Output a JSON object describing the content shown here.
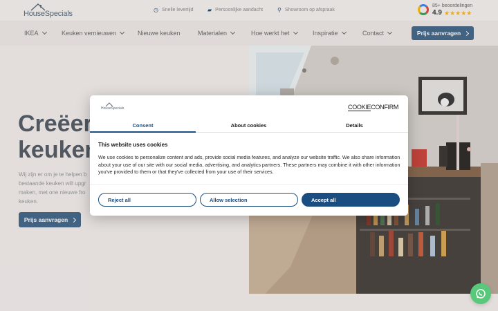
{
  "brand": {
    "name": "HouseSpecials"
  },
  "topbar": {
    "usps": [
      {
        "icon": "clock-icon",
        "label": "Snelle levertijd"
      },
      {
        "icon": "chat-icon",
        "label": "Persoonlijke aandacht"
      },
      {
        "icon": "location-pin-icon",
        "label": "Showroom op afspraak"
      }
    ],
    "google": {
      "count": "85+ beoordelingen",
      "rating": "4.9",
      "stars": "★★★★★"
    }
  },
  "nav": {
    "items": [
      {
        "label": "IKEA",
        "dropdown": true
      },
      {
        "label": "Keuken vernieuwen",
        "dropdown": true
      },
      {
        "label": "Nieuwe keuken",
        "dropdown": false
      },
      {
        "label": "Materialen",
        "dropdown": true
      },
      {
        "label": "Hoe werkt het",
        "dropdown": true
      },
      {
        "label": "Inspiratie",
        "dropdown": true
      },
      {
        "label": "Contact",
        "dropdown": true
      }
    ],
    "cta": "Prijs aanvragen"
  },
  "hero": {
    "title_line1": "Creëer",
    "title_line2": "keuken",
    "text": "Wij zijn er om je te helpen b... bestaande keuken wilt upgr... maken, met one nieuwe fro... keuken.",
    "text_lines": [
      "Wij zijn er om je te helpen b",
      "bestaande keuken wilt upgr",
      "maken, met one nieuwe fro",
      "keuken."
    ],
    "cta": "Prijs aanvragen"
  },
  "cookie": {
    "provider_left": "COOKIE",
    "provider_right": "CONFIRM",
    "tabs": [
      "Consent",
      "About cookies",
      "Details"
    ],
    "active_tab": "Consent",
    "heading": "This website uses cookies",
    "body": "We use cookies to personalize content and ads, provide social media features, and analyze our website traffic. We also share information about your use of our site with our social media, advertising, and analytics partners. These partners may combine it with other information you've provided to them or that they've collected from your use of their services.",
    "buttons": {
      "reject": "Reject all",
      "selection": "Allow selection",
      "accept": "Accept all"
    }
  },
  "colors": {
    "accent": "#45688a",
    "cookie_blue": "#1a4d80",
    "whatsapp": "#58c97a",
    "stars": "#f2b636"
  }
}
